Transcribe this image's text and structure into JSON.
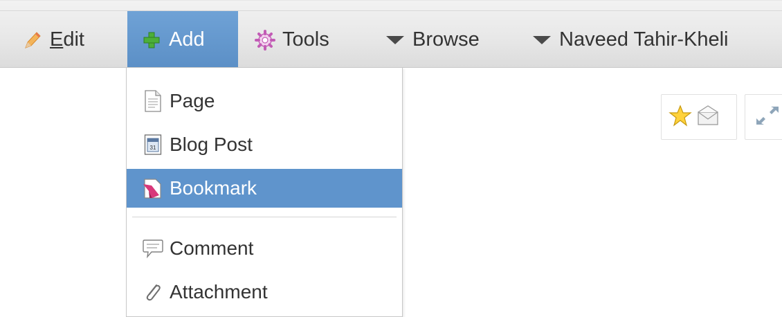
{
  "toolbar": {
    "edit_label_first": "E",
    "edit_label_rest": "dit",
    "add_label": "Add",
    "tools_label": "Tools",
    "browse_label": "Browse",
    "user_label": "Naveed Tahir-Kheli"
  },
  "add_menu": {
    "selected_index": 2,
    "items": [
      {
        "label": "Page",
        "icon": "page-icon"
      },
      {
        "label": "Blog Post",
        "icon": "blog-post-icon"
      },
      {
        "label": "Bookmark",
        "icon": "bookmark-icon"
      },
      {
        "label": "Comment",
        "icon": "comment-icon"
      },
      {
        "label": "Attachment",
        "icon": "paperclip-icon"
      }
    ]
  },
  "page_actions": {
    "icons": [
      "star-icon",
      "envelope-icon",
      "expand-icon"
    ]
  },
  "colors": {
    "toolbar_bg": "#e8e8e8",
    "active_blue": "#5f94cc",
    "text": "#333333"
  }
}
